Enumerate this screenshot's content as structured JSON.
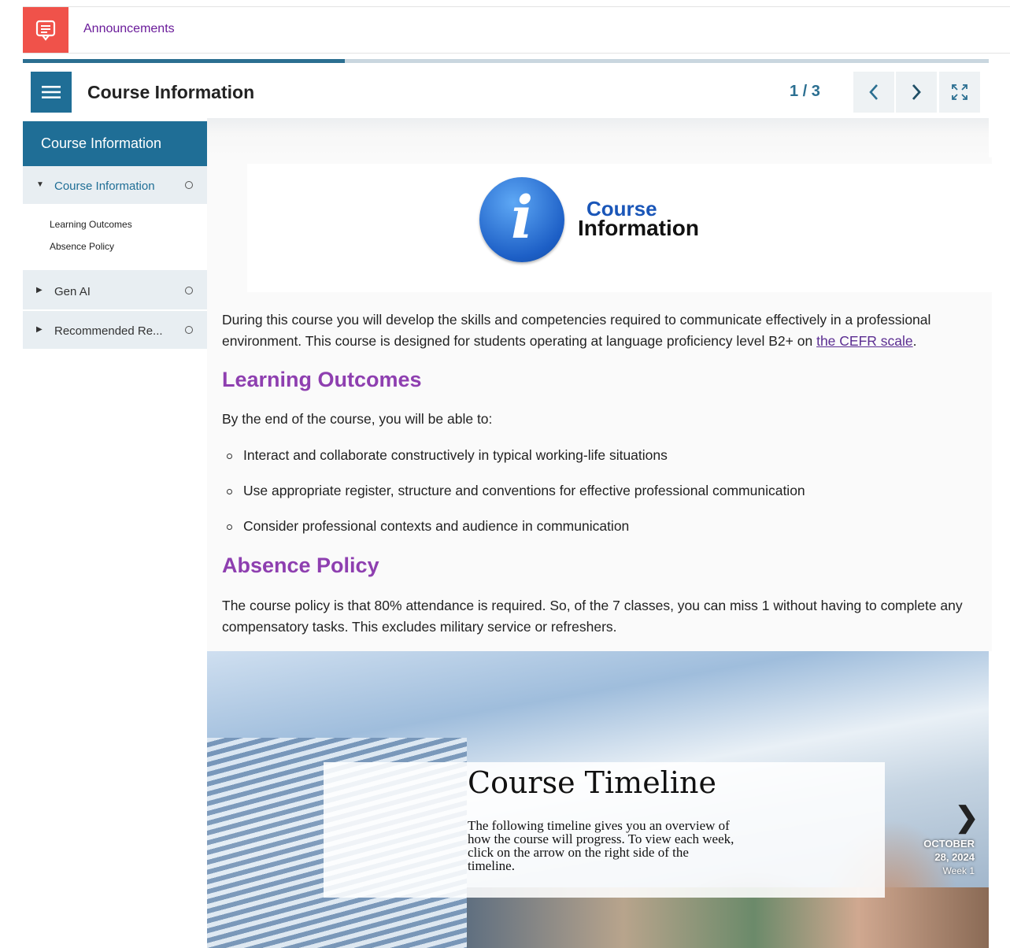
{
  "announcements": {
    "label": "Announcements"
  },
  "progress": {
    "fraction": 0.333
  },
  "header": {
    "title": "Course Information",
    "counter": "1 / 3"
  },
  "sidebar": {
    "heading": "Course Information",
    "items": [
      {
        "label": "Course Information",
        "expanded": true,
        "sub": [
          "Learning Outcomes",
          "Absence Policy"
        ]
      },
      {
        "label": "Gen AI",
        "expanded": false
      },
      {
        "label": "Recommended Re...",
        "expanded": false
      }
    ]
  },
  "hero": {
    "glyph": "i",
    "line1": "Course",
    "line2": "Information"
  },
  "content": {
    "intro": "During this course you will develop the skills and competencies required to communicate effectively in a professional environment. This course is designed for students operating at language proficiency level B2+ on ",
    "intro_link": "the CEFR scale",
    "intro_end": ".",
    "outcomes_heading": "Learning Outcomes",
    "outcomes_lead": "By the end of the course, you will be able to:",
    "outcomes": [
      "Interact and collaborate constructively in typical working-life situations",
      "Use appropriate register, structure and conventions for effective professional communication",
      "Consider professional contexts and audience in communication"
    ],
    "absence_heading": "Absence Policy",
    "absence_text": "The course policy is that 80% attendance is required. So, of the 7 classes, you can miss 1 without having to complete any compensatory tasks. This excludes military service or refreshers."
  },
  "timeline": {
    "title": "Course Timeline",
    "description": "The following timeline gives you an overview of how the course will progress. To view each week, click on the arrow on the right side of the timeline.",
    "date_line1": "OCTOBER",
    "date_line2": "28, 2024",
    "week": "Week 1"
  },
  "colors": {
    "accent": "#1f6e96",
    "announcement": "#f0524a",
    "heading": "#8e3fb0"
  }
}
